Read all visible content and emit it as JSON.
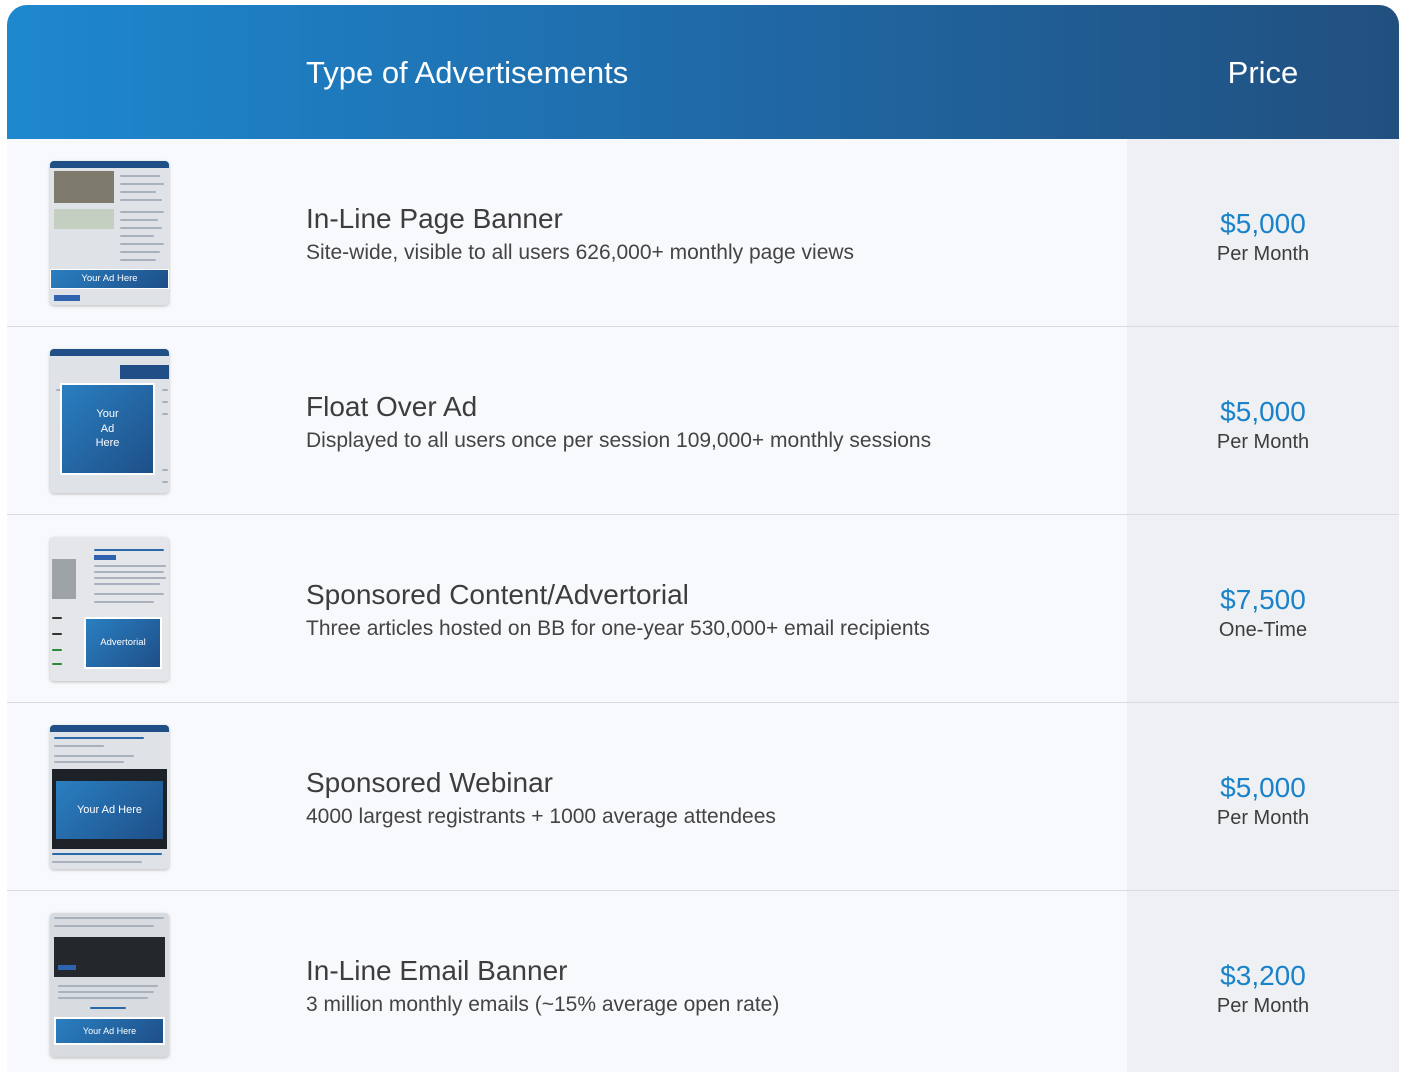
{
  "header": {
    "type_label": "Type of Advertisements",
    "price_label": "Price"
  },
  "colors": {
    "header_gradient_start": "#1e88cf",
    "header_gradient_end": "#21507f",
    "price_accent": "#1a82c8"
  },
  "rows": [
    {
      "thumb_ad_text": "Your Ad Here",
      "title": "In-Line Page Banner",
      "description": "Site-wide, visible to all users 626,000+ monthly page views",
      "price": "$5,000",
      "period": "Per Month"
    },
    {
      "thumb_ad_text": "Your\nAd\nHere",
      "title": "Float Over Ad",
      "description": "Displayed to all users once per session 109,000+ monthly sessions",
      "price": "$5,000",
      "period": "Per Month"
    },
    {
      "thumb_ad_text": "Advertorial",
      "title": "Sponsored Content/Advertorial",
      "description": "Three articles hosted on BB for one-year 530,000+ email recipients",
      "price": "$7,500",
      "period": "One-Time"
    },
    {
      "thumb_ad_text": "Your Ad Here",
      "title": "Sponsored Webinar",
      "description": "4000 largest registrants + 1000 average attendees",
      "price": "$5,000",
      "period": "Per Month"
    },
    {
      "thumb_ad_text": "Your Ad Here",
      "title": "In-Line Email Banner",
      "description": "3 million monthly emails (~15% average open rate)",
      "price": "$3,200",
      "period": "Per Month"
    }
  ]
}
